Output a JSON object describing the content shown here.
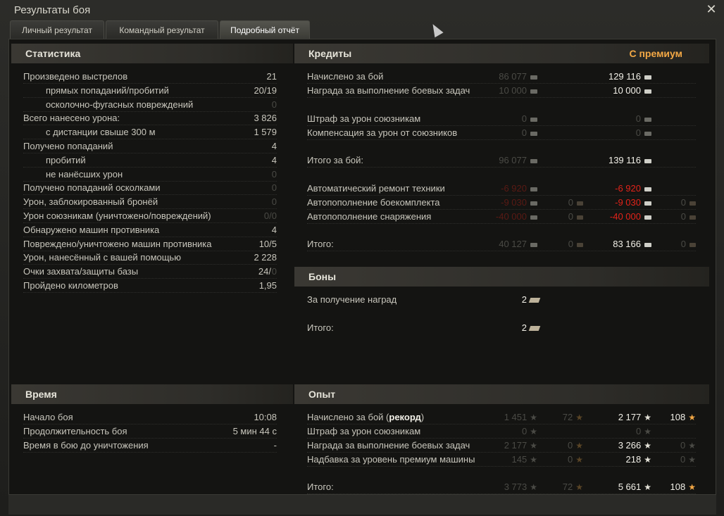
{
  "window": {
    "title": "Результаты боя"
  },
  "tabs": [
    {
      "label": "Личный результат"
    },
    {
      "label": "Командный результат"
    },
    {
      "label": "Подробный отчёт"
    }
  ],
  "stats": {
    "header": "Статистика",
    "rows": [
      {
        "label": "Произведено выстрелов",
        "value": "21"
      },
      {
        "label": "прямых попаданий/пробитий",
        "value": "20/19"
      },
      {
        "label": "осколочно-фугасных повреждений",
        "value": "0"
      },
      {
        "label": "Всего нанесено урона:",
        "value": "3 826"
      },
      {
        "label": "с дистанции свыше 300 м",
        "value": "1 579"
      },
      {
        "label": "Получено попаданий",
        "value": "4"
      },
      {
        "label": "пробитий",
        "value": "4"
      },
      {
        "label": "не нанёсших урон",
        "value": "0"
      },
      {
        "label": "Получено попаданий осколками",
        "value": "0"
      },
      {
        "label": "Урон, заблокированный бронёй",
        "value": "0"
      },
      {
        "label": "Урон союзникам (уничтожено/повреждений)",
        "value": "0/0"
      },
      {
        "label": "Обнаружено машин противника",
        "value": "4"
      },
      {
        "label": "Повреждено/уничтожено машин противника",
        "value": "10/5"
      },
      {
        "label": "Урон, нанесённый с вашей помощью",
        "value": "2 228"
      },
      {
        "label": "Очки захвата/защиты базы",
        "value": "24/",
        "value2": "0"
      },
      {
        "label": "Пройдено километров",
        "value": "1,95"
      }
    ]
  },
  "credits": {
    "header": "Кредиты",
    "premium_label": "С премиум",
    "rows": [
      {
        "label": "Начислено за бой",
        "base": "86 077",
        "prem": "129 116"
      },
      {
        "label": "Награда за выполнение боевых задач",
        "base": "10 000",
        "prem": "10 000"
      },
      {
        "label": "Штраф за урон союзникам",
        "base": "0",
        "prem": "0"
      },
      {
        "label": "Компенсация за урон от союзников",
        "base": "0",
        "prem": "0"
      },
      {
        "label": "Итого за бой:",
        "base": "96 077",
        "prem": "139 116"
      },
      {
        "label": "Автоматический ремонт техники",
        "base": "-6 920",
        "prem": "-6 920"
      },
      {
        "label": "Автопополнение боекомплекта",
        "base": "-9 030",
        "base_gold": "0",
        "prem": "-9 030",
        "prem_gold": "0"
      },
      {
        "label": "Автопополнение снаряжения",
        "base": "-40 000",
        "base_gold": "0",
        "prem": "-40 000",
        "prem_gold": "0"
      },
      {
        "label": "Итого:",
        "base": "40 127",
        "base_gold": "0",
        "prem": "83 166",
        "prem_gold": "0"
      }
    ]
  },
  "bonds": {
    "header": "Боны",
    "rows": [
      {
        "label": "За получение наград",
        "value": "2"
      },
      {
        "label": "Итого:",
        "value": "2"
      }
    ]
  },
  "time": {
    "header": "Время",
    "rows": [
      {
        "label": "Начало боя",
        "value": "10:08"
      },
      {
        "label": "Продолжительность боя",
        "value": "5 мин 44 с"
      },
      {
        "label": "Время в бою до уничтожения",
        "value": "-"
      }
    ]
  },
  "xp": {
    "header": "Опыт",
    "rows": [
      {
        "label": "Начислено за бой (",
        "label_bold": "рекорд",
        "label_end": ")",
        "base": "1 451",
        "base_free": "72",
        "prem": "2 177",
        "prem_free": "108"
      },
      {
        "label": "Штраф за урон союзникам",
        "base": "0",
        "prem": "0"
      },
      {
        "label": "Награда за выполнение боевых задач",
        "base": "2 177",
        "base_free": "0",
        "prem": "3 266",
        "prem_free": "0"
      },
      {
        "label": "Надбавка за уровень премиум машины",
        "base": "145",
        "base_free": "0",
        "prem": "218",
        "prem_free": "0"
      },
      {
        "label": "Итого:",
        "base": "3 773",
        "base_free": "72",
        "prem": "5 661",
        "prem_free": "108"
      }
    ]
  },
  "icons": {
    "close": "close-icon",
    "credit": "credit-icon",
    "gold": "gold-icon",
    "bond": "bond-icon",
    "xp": "xp-star-icon",
    "free_xp": "free-xp-star-icon"
  },
  "colors": {
    "premium": "#f3a845",
    "negative": "#e2231a",
    "header_bg": "#3a3833"
  }
}
